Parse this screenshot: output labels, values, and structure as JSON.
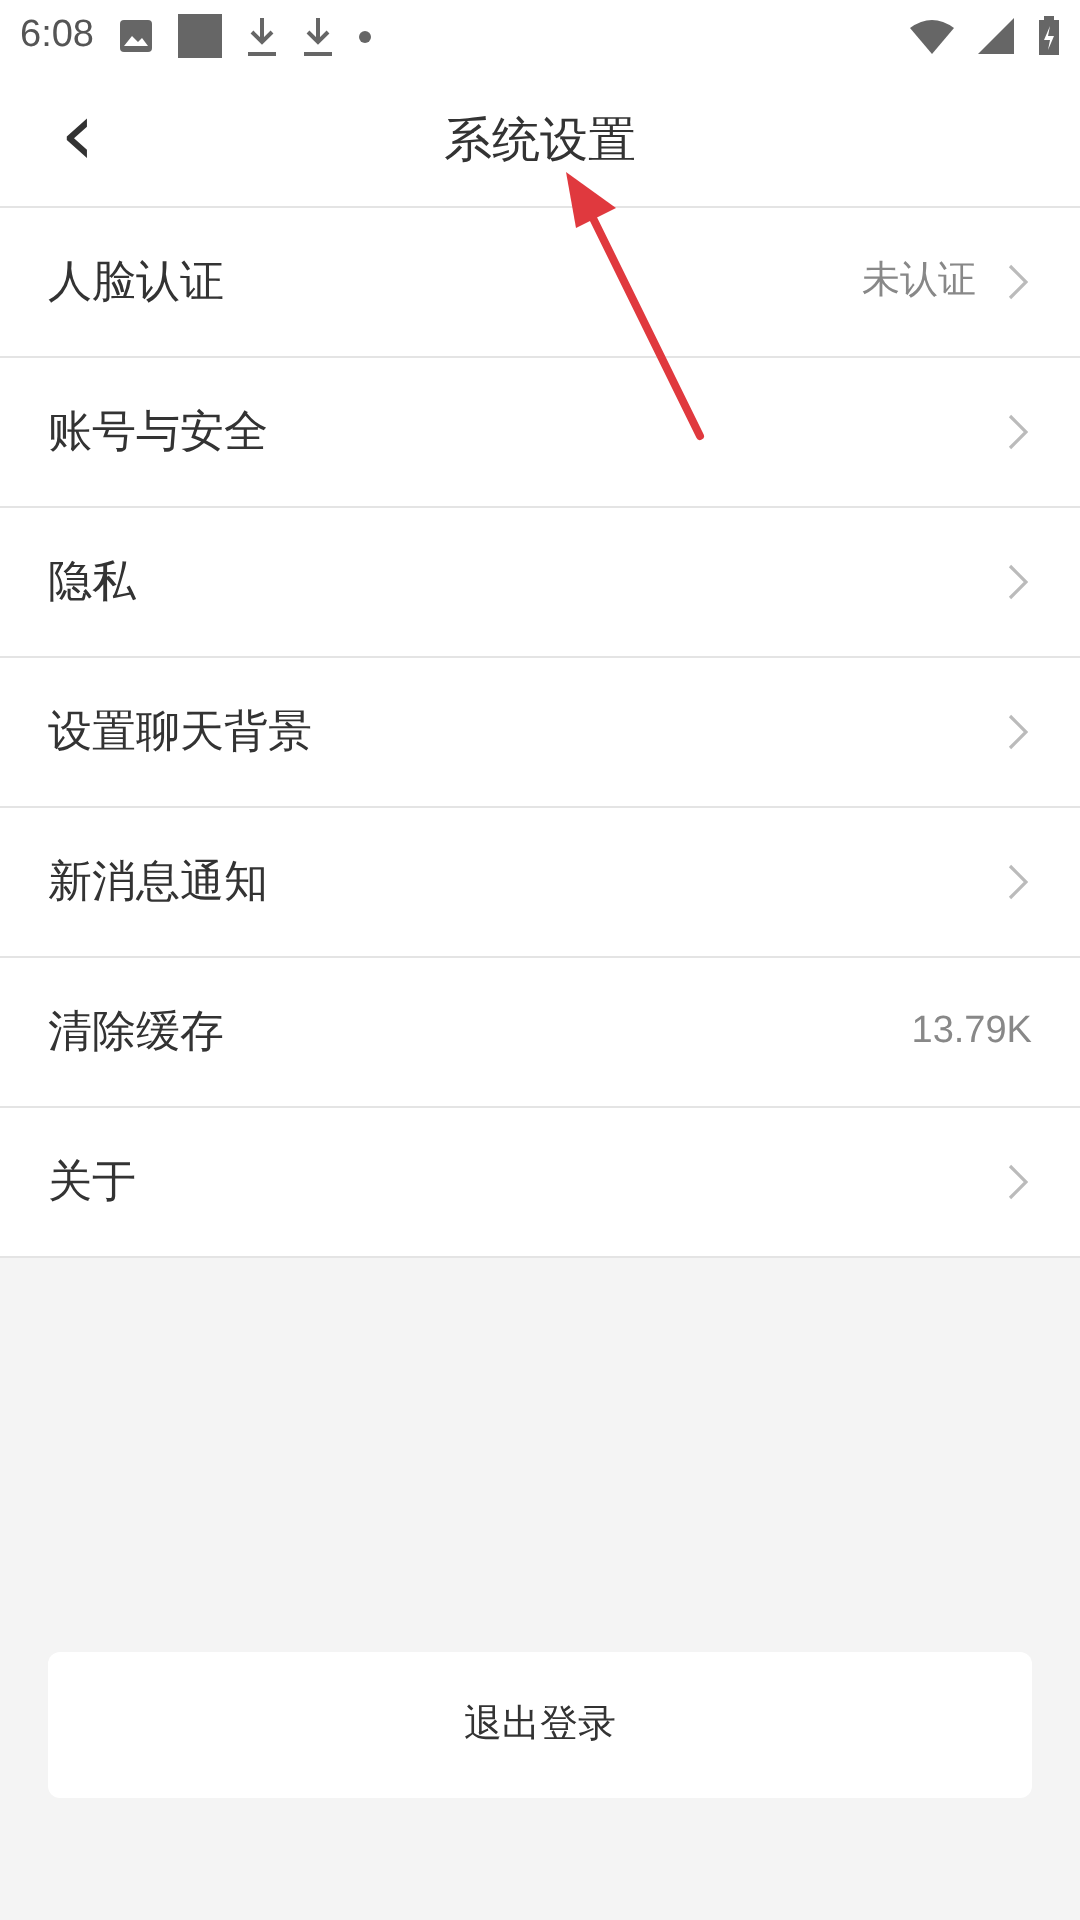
{
  "status_bar": {
    "time": "6:08"
  },
  "header": {
    "back_icon": "‹",
    "title": "系统设置"
  },
  "settings": [
    {
      "label": "人脸认证",
      "value": "未认证",
      "chevron": true
    },
    {
      "label": "账号与安全",
      "chevron": true
    },
    {
      "label": "隐私",
      "chevron": true
    },
    {
      "label": "设置聊天背景",
      "chevron": true
    },
    {
      "label": "新消息通知",
      "chevron": true
    },
    {
      "label": "清除缓存",
      "value": "13.79K",
      "chevron": false
    },
    {
      "label": "关于",
      "chevron": true
    }
  ],
  "logout_button": "退出登录"
}
